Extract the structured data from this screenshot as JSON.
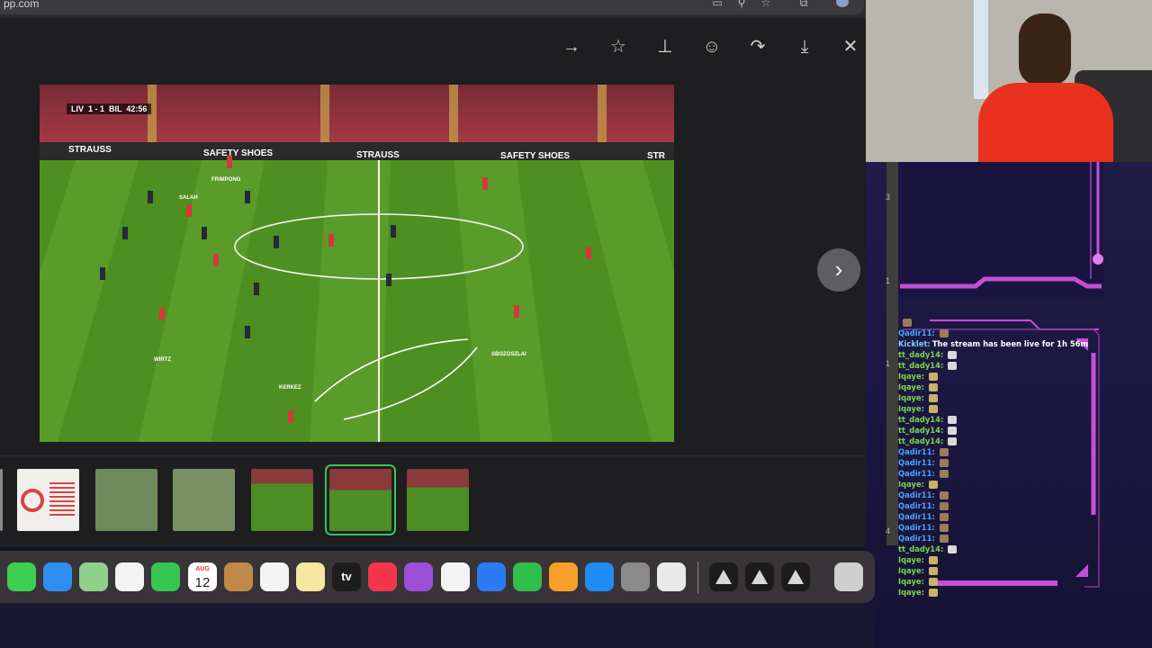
{
  "browser": {
    "url": "pp.com",
    "icons": [
      "screen-share-icon",
      "zoom-icon",
      "bookmark-star-icon",
      "extension-icon",
      "profile-avatar"
    ]
  },
  "viewer": {
    "toolbar": [
      "forward-arrow-icon",
      "favorite-star-icon",
      "pin-icon",
      "emoji-icon",
      "share-icon",
      "download-icon",
      "close-icon"
    ],
    "next_label": "›"
  },
  "match": {
    "scoreboard": "LIV  1 - 1  BIL  42:56",
    "banners": [
      "STRAUSS",
      "SAFETY SHOES",
      "STRAUSS",
      "SAFETY SHOES",
      "STR"
    ],
    "player_labels": [
      "FRIMPONG",
      "SALAH",
      "WIRTZ",
      "KERKEZ",
      "SBOZOSZLAI"
    ]
  },
  "calendar": {
    "month": "AUG",
    "day": "12"
  },
  "dock_apps": [
    "Messages",
    "Mail",
    "Maps",
    "Photos",
    "FaceTime",
    "Calendar",
    "Contacts",
    "Reminders",
    "Notes",
    "Apple TV",
    "Music",
    "Podcasts",
    "News",
    "Keynote",
    "Numbers",
    "Pages",
    "App Store",
    "System Settings",
    "iPhone Mirroring",
    "Stream App 1",
    "Stream App 2",
    "Stream App 3",
    "Trash"
  ],
  "side_marks": [
    "3",
    "1",
    "1",
    "4"
  ],
  "chat": [
    {
      "user": "",
      "msg": "",
      "color": "#4aa3ff",
      "emote": "#9b7b5a"
    },
    {
      "user": "Qadir11:",
      "msg": "",
      "color": "#4aa3ff",
      "emote": "#9b7b5a"
    },
    {
      "user": "Kicklet:",
      "msg": "The stream has been live for 1h 56m .",
      "color": "#7ec8ff",
      "emote": ""
    },
    {
      "user": "tt_dady14:",
      "msg": "",
      "color": "#7cd64a",
      "emote": "#d9d9d9"
    },
    {
      "user": "tt_dady14:",
      "msg": "",
      "color": "#7cd64a",
      "emote": "#d9d9d9"
    },
    {
      "user": "Iqaye:",
      "msg": "",
      "color": "#7cd64a",
      "emote": "#c9b26a"
    },
    {
      "user": "Iqaye:",
      "msg": "",
      "color": "#7cd64a",
      "emote": "#c9b26a"
    },
    {
      "user": "Iqaye:",
      "msg": "",
      "color": "#7cd64a",
      "emote": "#c9b26a"
    },
    {
      "user": "Iqaye:",
      "msg": "",
      "color": "#7cd64a",
      "emote": "#c9b26a"
    },
    {
      "user": "tt_dady14:",
      "msg": "",
      "color": "#7cd64a",
      "emote": "#d9d9d9"
    },
    {
      "user": "tt_dady14:",
      "msg": "",
      "color": "#7cd64a",
      "emote": "#d9d9d9"
    },
    {
      "user": "tt_dady14:",
      "msg": "",
      "color": "#7cd64a",
      "emote": "#d9d9d9"
    },
    {
      "user": "Qadir11:",
      "msg": "",
      "color": "#4aa3ff",
      "emote": "#9b7b5a"
    },
    {
      "user": "Qadir11:",
      "msg": "",
      "color": "#4aa3ff",
      "emote": "#9b7b5a"
    },
    {
      "user": "Qadir11:",
      "msg": "",
      "color": "#4aa3ff",
      "emote": "#9b7b5a"
    },
    {
      "user": "Iqaye:",
      "msg": "",
      "color": "#7cd64a",
      "emote": "#c9b26a"
    },
    {
      "user": "Qadir11:",
      "msg": "",
      "color": "#4aa3ff",
      "emote": "#9b7b5a"
    },
    {
      "user": "Qadir11:",
      "msg": "",
      "color": "#4aa3ff",
      "emote": "#9b7b5a"
    },
    {
      "user": "Qadir11:",
      "msg": "",
      "color": "#4aa3ff",
      "emote": "#9b7b5a"
    },
    {
      "user": "Qadir11:",
      "msg": "",
      "color": "#4aa3ff",
      "emote": "#9b7b5a"
    },
    {
      "user": "Qadir11:",
      "msg": "",
      "color": "#4aa3ff",
      "emote": "#9b7b5a"
    },
    {
      "user": "tt_dady14:",
      "msg": "",
      "color": "#7cd64a",
      "emote": "#d9d9d9"
    },
    {
      "user": "Iqaye:",
      "msg": "",
      "color": "#7cd64a",
      "emote": "#c9b26a"
    },
    {
      "user": "Iqaye:",
      "msg": "",
      "color": "#7cd64a",
      "emote": "#c9b26a"
    },
    {
      "user": "Iqaye:",
      "msg": "",
      "color": "#7cd64a",
      "emote": "#c9b26a"
    },
    {
      "user": "Iqaye:",
      "msg": "",
      "color": "#7cd64a",
      "emote": "#c9b26a"
    }
  ]
}
